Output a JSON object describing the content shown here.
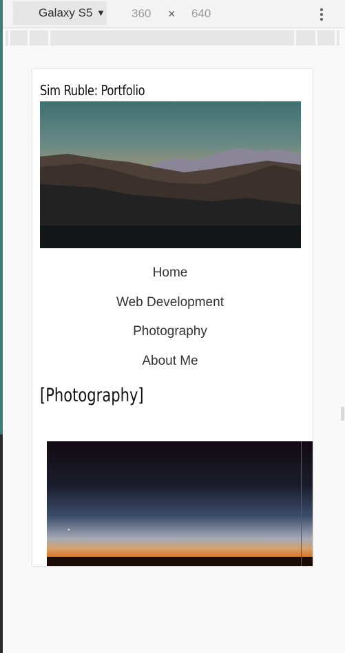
{
  "toolbar": {
    "device": "Galaxy S5",
    "width": "360",
    "times": "×",
    "height": "640"
  },
  "site": {
    "title": "Sim Ruble: Portfolio"
  },
  "nav": {
    "items": [
      {
        "label": "Home"
      },
      {
        "label": "Web Development"
      },
      {
        "label": "Photography"
      },
      {
        "label": "About Me"
      }
    ]
  },
  "section": {
    "title": "[Photography]"
  },
  "colors": {
    "accent_edge": "#3b7d72",
    "page_bg": "#f8f8f8",
    "toolbar_bg": "#f3f3f3"
  },
  "icons": {
    "device_caret": "caret-down-icon",
    "menu": "more-vert-icon"
  }
}
